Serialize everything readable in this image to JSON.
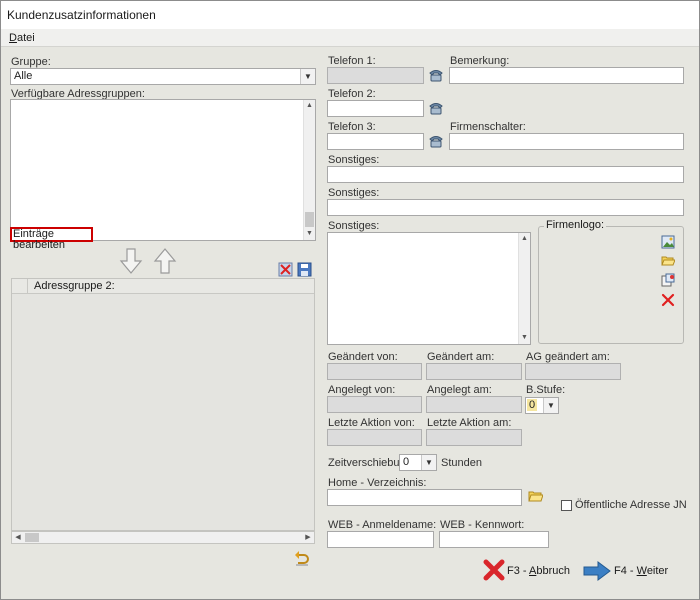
{
  "window": {
    "title": "Kundenzusatzinformationen"
  },
  "menu": {
    "file_prefix": "",
    "file_mnemonic": "D",
    "file_rest": "atei"
  },
  "left": {
    "gruppe_label": "Gruppe:",
    "gruppe_value": "Alle",
    "adressgruppen_label": "Verfügbare Adressgruppen:",
    "edit_entries_link": "Einträge bearbeiten",
    "grid_header": "Adressgruppe 2:"
  },
  "right": {
    "telefon1_label": "Telefon 1:",
    "telefon2_label": "Telefon 2:",
    "telefon3_label": "Telefon 3:",
    "bemerkung_label": "Bemerkung:",
    "firmenschalter_label": "Firmenschalter:",
    "sonstiges1_label": "Sonstiges:",
    "sonstiges2_label": "Sonstiges:",
    "sonstiges3_label": "Sonstiges:",
    "firmenlogo_label": "Firmenlogo:",
    "geaendert_von_label": "Geändert von:",
    "geaendert_am_label": "Geändert am:",
    "ag_geaendert_am_label": "AG geändert am:",
    "angelegt_von_label": "Angelegt von:",
    "angelegt_am_label": "Angelegt am:",
    "bstufe_label": "B.Stufe:",
    "bstufe_value": "0",
    "letzte_aktion_von_label": "Letzte Aktion von:",
    "letzte_aktion_am_label": "Letzte Aktion am:",
    "zeitverschiebung_label": "Zeitverschiebung:",
    "zeitverschiebung_value": "0",
    "stunden_label": "Stunden",
    "home_label": "Home - Verzeichnis:",
    "oeffentlich_label": "Öffentliche Adresse JN",
    "web_anmelde_label": "WEB - Anmeldename:",
    "web_kennwort_label": "WEB - Kennwort:"
  },
  "buttons": {
    "cancel_prefix": "F3 - ",
    "cancel_mnemonic": "A",
    "cancel_rest": "bbruch",
    "next_prefix": "F4 - ",
    "next_mnemonic": "W",
    "next_rest": "eiter"
  },
  "colors": {
    "window_bg": "#e6e6e0",
    "highlight_border": "#cc0000",
    "cancel_red": "#d9262b",
    "next_blue": "#3b7fc4"
  }
}
